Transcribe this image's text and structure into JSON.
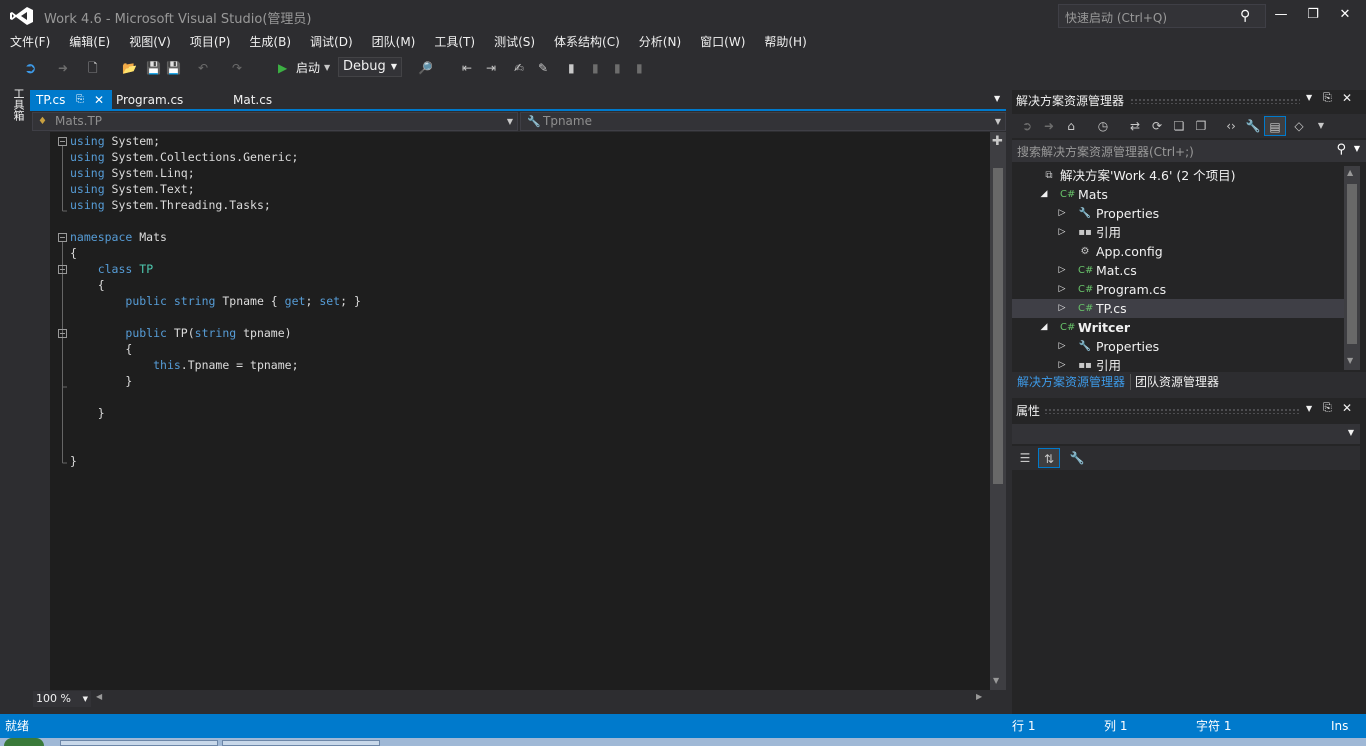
{
  "window": {
    "title": "Work 4.6 - Microsoft Visual Studio(管理员)",
    "quick_launch_placeholder": "快速启动 (Ctrl+Q)"
  },
  "menu": [
    "文件(F)",
    "编辑(E)",
    "视图(V)",
    "项目(P)",
    "生成(B)",
    "调试(D)",
    "团队(M)",
    "工具(T)",
    "测试(S)",
    "体系结构(C)",
    "分析(N)",
    "窗口(W)",
    "帮助(H)"
  ],
  "toolbar": {
    "start_label": "启动",
    "config": "Debug"
  },
  "toolbox_label": "工具箱",
  "editor": {
    "tabs": [
      "TP.cs",
      "Program.cs",
      "Mat.cs"
    ],
    "active_tab": "TP.cs",
    "nav_type": "Mats.TP",
    "nav_member": "Tpname",
    "zoom": "100 %",
    "code": [
      [
        {
          "t": "using",
          "c": "kw"
        },
        {
          "t": " System;"
        }
      ],
      [
        {
          "t": "using",
          "c": "kw"
        },
        {
          "t": " System.Collections.Generic;"
        }
      ],
      [
        {
          "t": "using",
          "c": "kw"
        },
        {
          "t": " System.Linq;"
        }
      ],
      [
        {
          "t": "using",
          "c": "kw"
        },
        {
          "t": " System.Text;"
        }
      ],
      [
        {
          "t": "using",
          "c": "kw"
        },
        {
          "t": " System.Threading.Tasks;"
        }
      ],
      [],
      [
        {
          "t": "namespace",
          "c": "kw"
        },
        {
          "t": " Mats"
        }
      ],
      [
        {
          "t": "{"
        }
      ],
      [
        {
          "t": "    "
        },
        {
          "t": "class",
          "c": "kw"
        },
        {
          "t": " "
        },
        {
          "t": "TP",
          "c": "ty"
        }
      ],
      [
        {
          "t": "    {"
        }
      ],
      [
        {
          "t": "        "
        },
        {
          "t": "public",
          "c": "kw"
        },
        {
          "t": " "
        },
        {
          "t": "string",
          "c": "kw"
        },
        {
          "t": " Tpname { "
        },
        {
          "t": "get",
          "c": "kw"
        },
        {
          "t": "; "
        },
        {
          "t": "set",
          "c": "kw"
        },
        {
          "t": "; }"
        }
      ],
      [],
      [
        {
          "t": "        "
        },
        {
          "t": "public",
          "c": "kw"
        },
        {
          "t": " TP("
        },
        {
          "t": "string",
          "c": "kw"
        },
        {
          "t": " tpname)"
        }
      ],
      [
        {
          "t": "        {"
        }
      ],
      [
        {
          "t": "            "
        },
        {
          "t": "this",
          "c": "kw"
        },
        {
          "t": ".Tpname = tpname;"
        }
      ],
      [
        {
          "t": "        }"
        }
      ],
      [],
      [
        {
          "t": "    }"
        }
      ],
      [],
      [],
      [
        {
          "t": "}"
        }
      ]
    ]
  },
  "solution_explorer": {
    "title": "解决方案资源管理器",
    "search_placeholder": "搜索解决方案资源管理器(Ctrl+;)",
    "tree": [
      {
        "label": "解决方案'Work 4.6' (2 个项目)",
        "indent": 0,
        "arrow": "",
        "icon": "solution-icon"
      },
      {
        "label": "Mats",
        "indent": 1,
        "arrow": "expanded",
        "icon": "csharp-project-icon"
      },
      {
        "label": "Properties",
        "indent": 2,
        "arrow": "collapsed",
        "icon": "wrench-icon"
      },
      {
        "label": "引用",
        "indent": 2,
        "arrow": "collapsed",
        "icon": "references-icon"
      },
      {
        "label": "App.config",
        "indent": 2,
        "arrow": "",
        "icon": "config-icon"
      },
      {
        "label": "Mat.cs",
        "indent": 2,
        "arrow": "collapsed",
        "icon": "csharp-file-icon"
      },
      {
        "label": "Program.cs",
        "indent": 2,
        "arrow": "collapsed",
        "icon": "csharp-file-icon"
      },
      {
        "label": "TP.cs",
        "indent": 2,
        "arrow": "collapsed",
        "icon": "csharp-file-icon",
        "selected": true
      },
      {
        "label": "Writcer",
        "indent": 1,
        "arrow": "expanded",
        "icon": "csharp-project-icon",
        "bold": true
      },
      {
        "label": "Properties",
        "indent": 2,
        "arrow": "collapsed",
        "icon": "wrench-icon"
      },
      {
        "label": "引用",
        "indent": 2,
        "arrow": "collapsed",
        "icon": "references-icon"
      }
    ],
    "bottom_tabs": [
      "解决方案资源管理器",
      "团队资源管理器"
    ]
  },
  "properties": {
    "title": "属性"
  },
  "status": {
    "ready": "就绪",
    "line": "行 1",
    "col": "列 1",
    "char": "字符 1",
    "mode": "Ins"
  },
  "colors": {
    "accent": "#007acc",
    "keyword": "#569cd6",
    "type": "#4ec9b0"
  }
}
